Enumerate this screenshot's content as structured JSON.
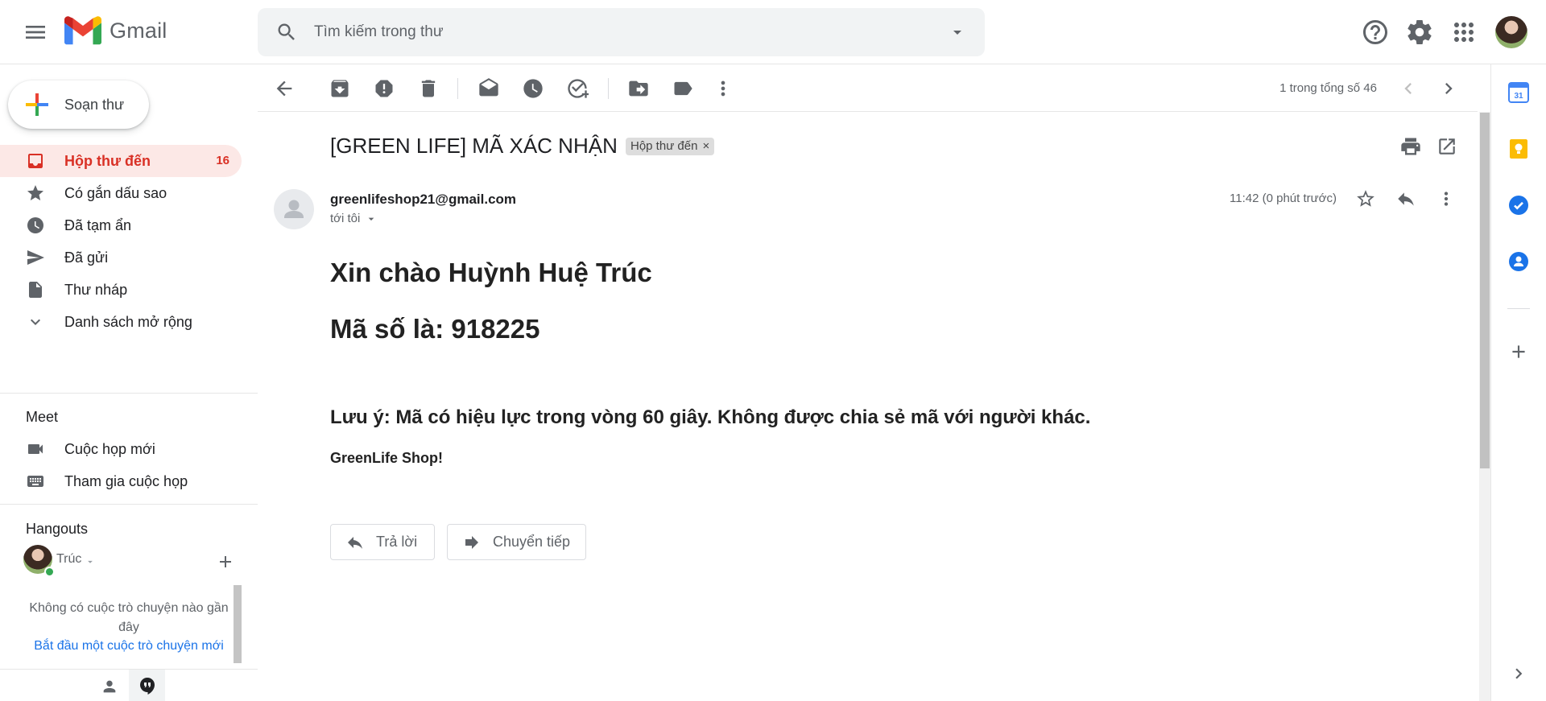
{
  "app": {
    "logo_text": "Gmail"
  },
  "search": {
    "placeholder": "Tìm kiếm trong thư"
  },
  "compose": {
    "label": "Soạn thư"
  },
  "nav": {
    "items": [
      {
        "label": "Hộp thư đến",
        "count": "16",
        "icon": "inbox-icon",
        "active": true
      },
      {
        "label": "Có gắn dấu sao",
        "icon": "star-icon"
      },
      {
        "label": "Đã tạm ẩn",
        "icon": "clock-icon"
      },
      {
        "label": "Đã gửi",
        "icon": "send-icon"
      },
      {
        "label": "Thư nháp",
        "icon": "draft-icon"
      },
      {
        "label": "Danh sách mở rộng",
        "icon": "chevron-down-icon"
      }
    ]
  },
  "meet": {
    "title": "Meet",
    "items": [
      {
        "label": "Cuộc họp mới",
        "icon": "video-icon"
      },
      {
        "label": "Tham gia cuộc họp",
        "icon": "keyboard-icon"
      }
    ]
  },
  "hangouts": {
    "title": "Hangouts",
    "user_name": "Trúc",
    "empty_text": "Không có cuộc trò chuyện nào gần đây",
    "start_link": "Bắt đầu một cuộc trò chuyện mới"
  },
  "toolbar": {
    "page_info": "1 trong tổng số 46"
  },
  "message": {
    "subject": "[GREEN LIFE] MÃ XÁC NHẬN",
    "label_chip": "Hộp thư đến",
    "chip_close": "×",
    "sender_email": "greenlifeshop21@gmail.com",
    "recipient": "tới tôi",
    "time": "11:42 (0 phút trước)",
    "greeting": "Xin chào Huỳnh Huệ Trúc",
    "code_line": "Mã số là: 918225",
    "note": "Lưu ý: Mã có hiệu lực trong vòng 60 giây. Không được chia sẻ mã với người khác.",
    "signature": "GreenLife Shop!",
    "reply_label": "Trả lời",
    "forward_label": "Chuyển tiếp"
  },
  "colors": {
    "accent_red": "#d93025",
    "active_bg": "#fce8e6",
    "link_blue": "#1a73e8",
    "icon_gray": "#5f6368"
  }
}
